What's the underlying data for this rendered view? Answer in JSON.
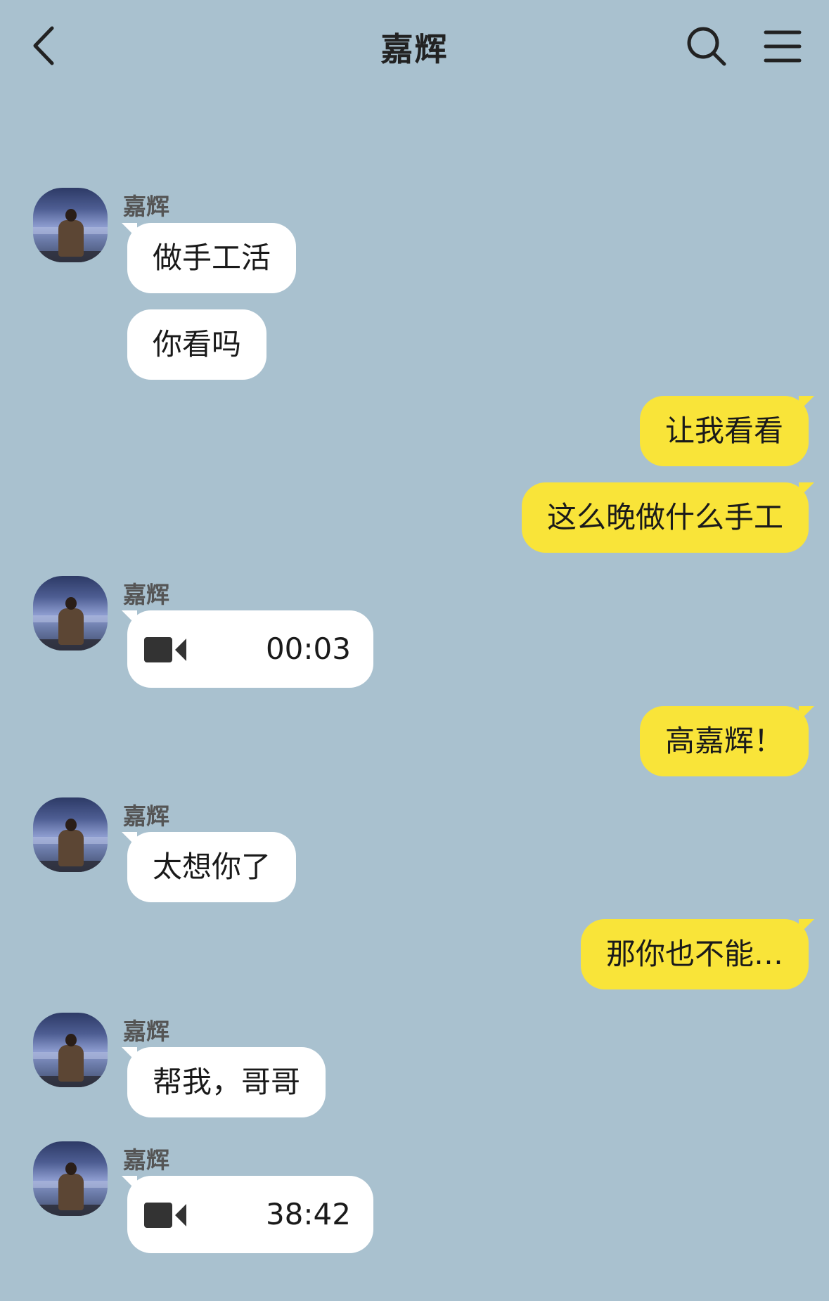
{
  "header": {
    "title": "嘉辉"
  },
  "icons": {
    "back": "chevron-left-icon",
    "search": "search-icon",
    "menu": "hamburger-menu-icon",
    "video": "video-camera-icon"
  },
  "colors": {
    "background": "#a9c1cf",
    "incoming_bubble": "#ffffff",
    "outgoing_bubble": "#f9e439"
  },
  "messages": [
    {
      "sender": "嘉辉",
      "direction": "in",
      "type": "text",
      "text": "做手工活"
    },
    {
      "direction": "in",
      "type": "text",
      "text": "你看吗"
    },
    {
      "direction": "out",
      "type": "text",
      "text": "让我看看"
    },
    {
      "direction": "out",
      "type": "text",
      "text": "这么晚做什么手工"
    },
    {
      "sender": "嘉辉",
      "direction": "in",
      "type": "video",
      "duration": "00:03"
    },
    {
      "direction": "out",
      "type": "text",
      "text": "高嘉辉！"
    },
    {
      "sender": "嘉辉",
      "direction": "in",
      "type": "text",
      "text": "太想你了"
    },
    {
      "direction": "out",
      "type": "text",
      "text": "那你也不能…"
    },
    {
      "sender": "嘉辉",
      "direction": "in",
      "type": "text",
      "text": "帮我，哥哥"
    },
    {
      "sender": "嘉辉",
      "direction": "in",
      "type": "video",
      "duration": "38:42"
    }
  ]
}
